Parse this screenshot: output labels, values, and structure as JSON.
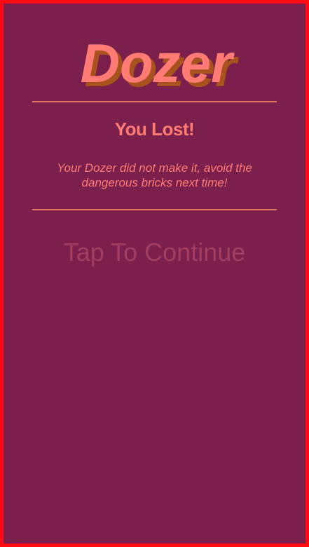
{
  "game": {
    "title": "Dozer",
    "status_heading": "You Lost!",
    "status_message": "Your Dozer did not make it, avoid the dangerous bricks next time!",
    "continue_label": "Tap To Continue"
  },
  "colors": {
    "background": "#7b1f4c",
    "frame_border": "#ff0a12",
    "logo_fill": "#ff7b73",
    "logo_shadow": "#a8531e",
    "text_accent": "#ff7b73",
    "divider": "#e0755e",
    "continue_text": "#a33e61"
  }
}
